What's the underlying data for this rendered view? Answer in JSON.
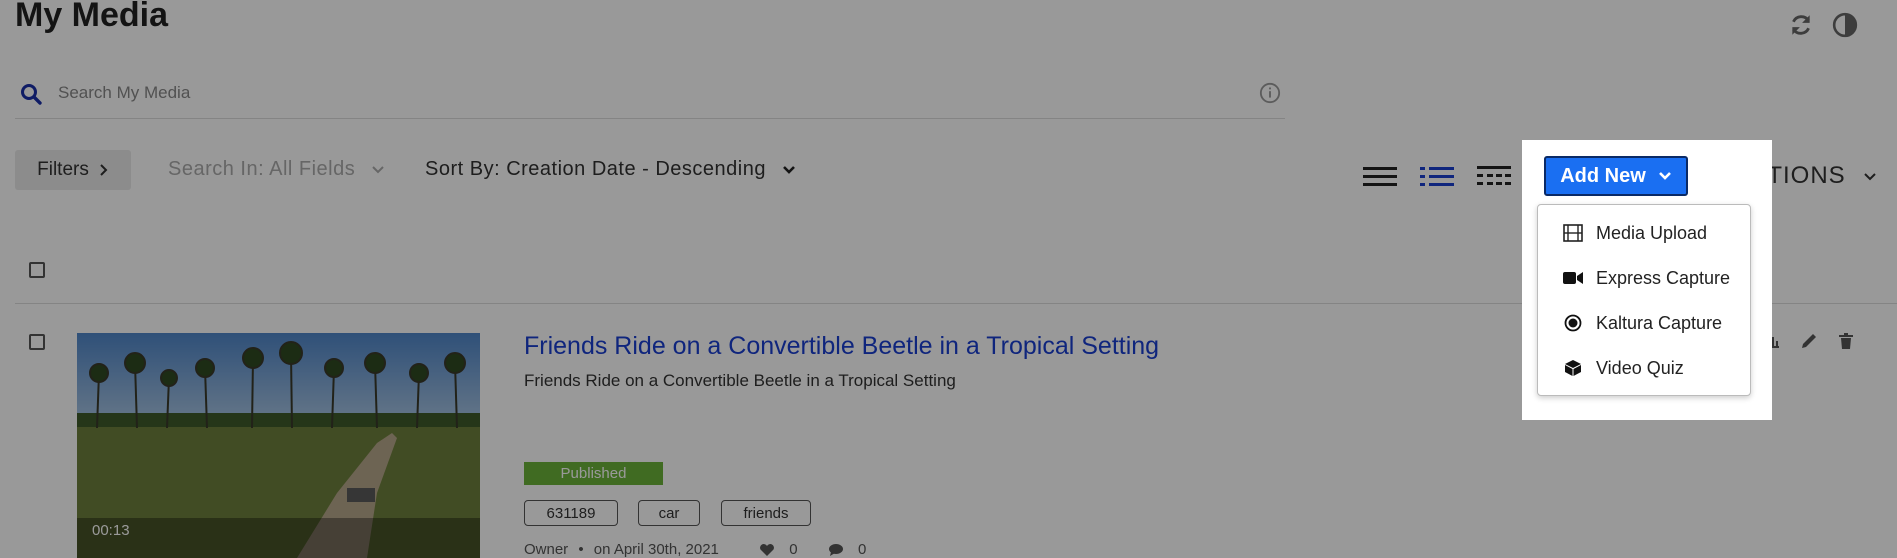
{
  "page": {
    "title": "My Media"
  },
  "header_icons": [
    {
      "icon": "refresh-icon"
    },
    {
      "icon": "contrast-icon"
    }
  ],
  "search": {
    "placeholder": "Search My Media",
    "icon": "search-icon",
    "info_icon": "info-icon"
  },
  "toolbar": {
    "filters_label": "Filters",
    "search_in_label": "Search In: All Fields",
    "sort_by_label": "Sort By: Creation Date - Descending",
    "views": [
      "details-view-icon",
      "list-view-icon",
      "compact-view-icon"
    ],
    "add_new_label": "Add New",
    "actions_label": "ACTIONS"
  },
  "add_new_menu": {
    "items": [
      {
        "label": "Media Upload",
        "icon": "film-icon"
      },
      {
        "label": "Express Capture",
        "icon": "video-camera-icon"
      },
      {
        "label": "Kaltura Capture",
        "icon": "record-icon"
      },
      {
        "label": "Video Quiz",
        "icon": "cube-icon"
      }
    ]
  },
  "entry": {
    "title": "Friends Ride on a Convertible Beetle in a Tropical Setting",
    "description": "Friends Ride on a Convertible Beetle in a Tropical Setting",
    "duration": "00:13",
    "status": "Published",
    "tags": [
      "631189",
      "car",
      "friends"
    ],
    "owner": "Owner",
    "date": "on April 30th, 2021",
    "likes": "0",
    "comments": "0",
    "row_actions": [
      "analytics-icon",
      "edit-icon",
      "delete-icon"
    ]
  },
  "colors": {
    "accent": "#1a6ff2",
    "link": "#1a3fd1",
    "published": "#6bb33a"
  }
}
